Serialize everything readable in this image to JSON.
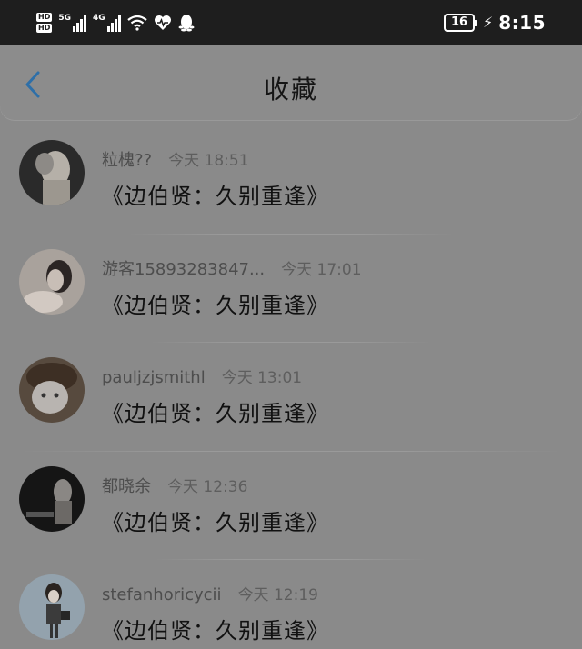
{
  "status_bar": {
    "hd_top": "HD",
    "hd_bottom": "HD",
    "net1_label": "5G",
    "net2_label": "4G",
    "battery_level": "16",
    "time": "8:15"
  },
  "header": {
    "title": "收藏"
  },
  "favorites": [
    {
      "user": "粒槐??",
      "time": "今天 18:51",
      "title": "《边伯贤：久别重逢》"
    },
    {
      "user": "游客15893283847...",
      "time": "今天 17:01",
      "title": "《边伯贤：久别重逢》"
    },
    {
      "user": "pauljzjsmithl",
      "time": "今天 13:01",
      "title": "《边伯贤：久别重逢》"
    },
    {
      "user": "都晓余",
      "time": "今天 12:36",
      "title": "《边伯贤：久别重逢》"
    },
    {
      "user": "stefanhoricycii",
      "time": "今天 12:19",
      "title": "《边伯贤：久别重逢》"
    }
  ]
}
